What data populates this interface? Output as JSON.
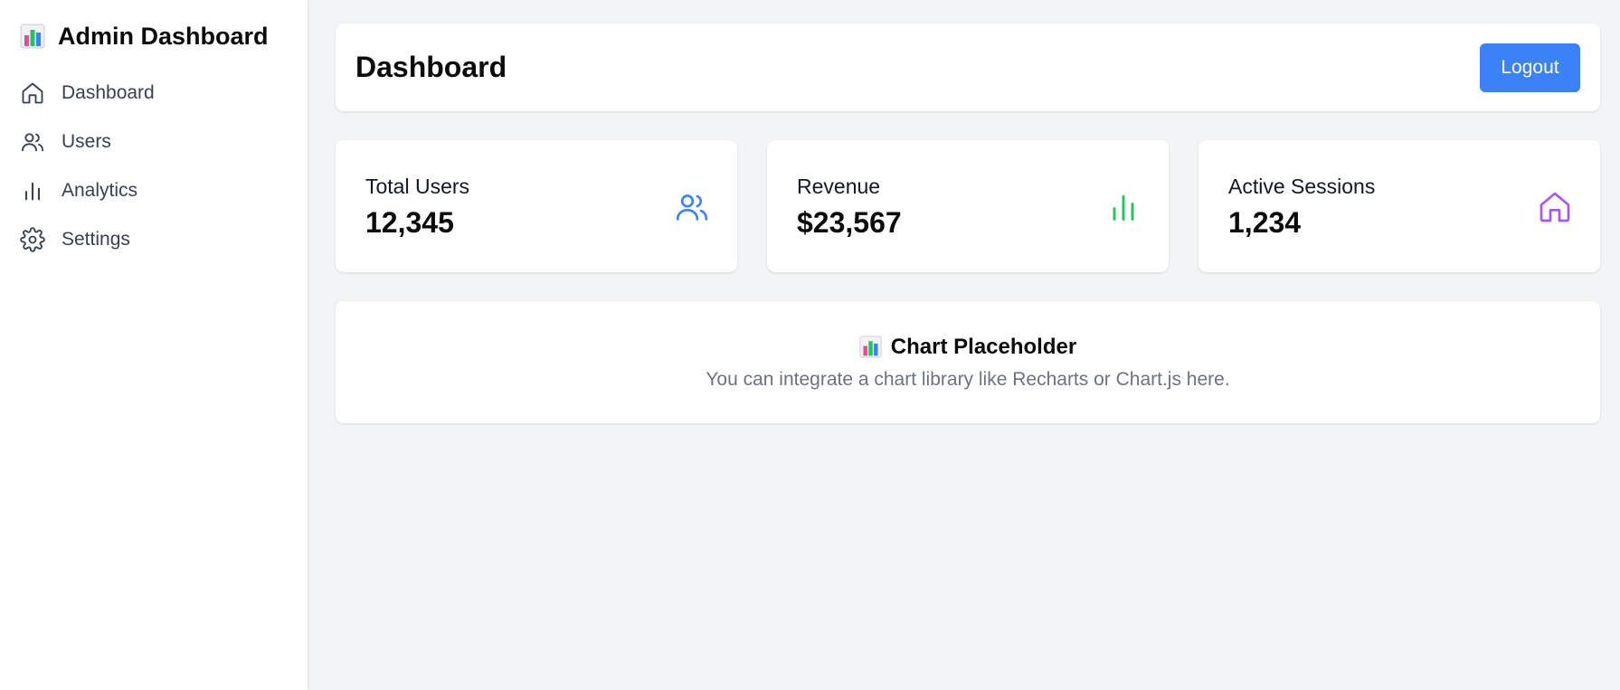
{
  "sidebar": {
    "brand": {
      "icon": "bar-chart-emoji-icon",
      "title": "Admin Dashboard"
    },
    "items": [
      {
        "label": "Dashboard",
        "icon": "home-icon"
      },
      {
        "label": "Users",
        "icon": "users-icon"
      },
      {
        "label": "Analytics",
        "icon": "bar-chart-icon"
      },
      {
        "label": "Settings",
        "icon": "gear-icon"
      }
    ]
  },
  "header": {
    "title": "Dashboard",
    "logout_label": "Logout"
  },
  "stats": [
    {
      "label": "Total Users",
      "value": "12,345",
      "icon": "users-icon",
      "color": "#3b82f6"
    },
    {
      "label": "Revenue",
      "value": "$23,567",
      "icon": "bar-chart-icon",
      "color": "#22c55e"
    },
    {
      "label": "Active Sessions",
      "value": "1,234",
      "icon": "home-icon",
      "color": "#a855f7"
    }
  ],
  "chart_placeholder": {
    "icon": "bar-chart-emoji-icon",
    "title": "Chart Placeholder",
    "description": "You can integrate a chart library like Recharts or Chart.js here."
  },
  "colors": {
    "accent": "#3b82f6",
    "background": "#f3f4f6",
    "card": "#ffffff",
    "muted_text": "#6b7280"
  }
}
